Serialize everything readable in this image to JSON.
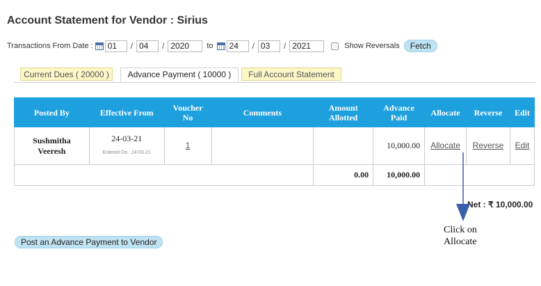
{
  "page": {
    "title": "Account Statement for Vendor : Sirius"
  },
  "filters": {
    "from_label": "Transactions From Date :",
    "from_day": "01",
    "from_month": "04",
    "from_year": "2020",
    "separator": "/",
    "to_label": "to",
    "to_day": "24",
    "to_month": "03",
    "to_year": "2021",
    "show_reversals_label": "Show Reversals",
    "show_reversals_checked": false,
    "fetch_label": "Fetch"
  },
  "tabs": [
    {
      "label": "Current Dues ( 20000 )",
      "active": false
    },
    {
      "label": "Advance Payment ( 10000 )",
      "active": true
    },
    {
      "label": "Full Account Statement",
      "active": false
    }
  ],
  "table": {
    "headers": {
      "posted_by": "Posted By",
      "effective_from": "Effective From",
      "voucher_no_1": "Voucher",
      "voucher_no_2": "No",
      "comments": "Comments",
      "amount_allotted_1": "Amount",
      "amount_allotted_2": "Allotted",
      "advance_paid_1": "Advance",
      "advance_paid_2": "Paid",
      "allocate": "Allocate",
      "reverse": "Reverse",
      "edit": "Edit"
    },
    "rows": [
      {
        "posted_by_first": "Sushmitha",
        "posted_by_last": "Veeresh",
        "effective_from": "24-03-21",
        "entered_on": "Entered On : 24-03-21",
        "voucher_no": "1",
        "comments": "",
        "amount_allotted": "",
        "advance_paid": "10,000.00",
        "allocate": "Allocate",
        "reverse": "Reverse",
        "edit": "Edit"
      }
    ],
    "totals": {
      "amount_allotted": "0.00",
      "advance_paid": "10,000.00"
    }
  },
  "net": {
    "text": "Net : ₹ 10,000.00"
  },
  "actions": {
    "post_advance_label": "Post an Advance Payment to Vendor"
  },
  "annotation": {
    "line1": "Click on",
    "line2": "Allocate",
    "color": "#3a5ea8"
  },
  "colors": {
    "header_bg": "#1ea0de",
    "tab_inactive_bg": "#fbf7c6",
    "button_bg": "#bfe3f3"
  }
}
